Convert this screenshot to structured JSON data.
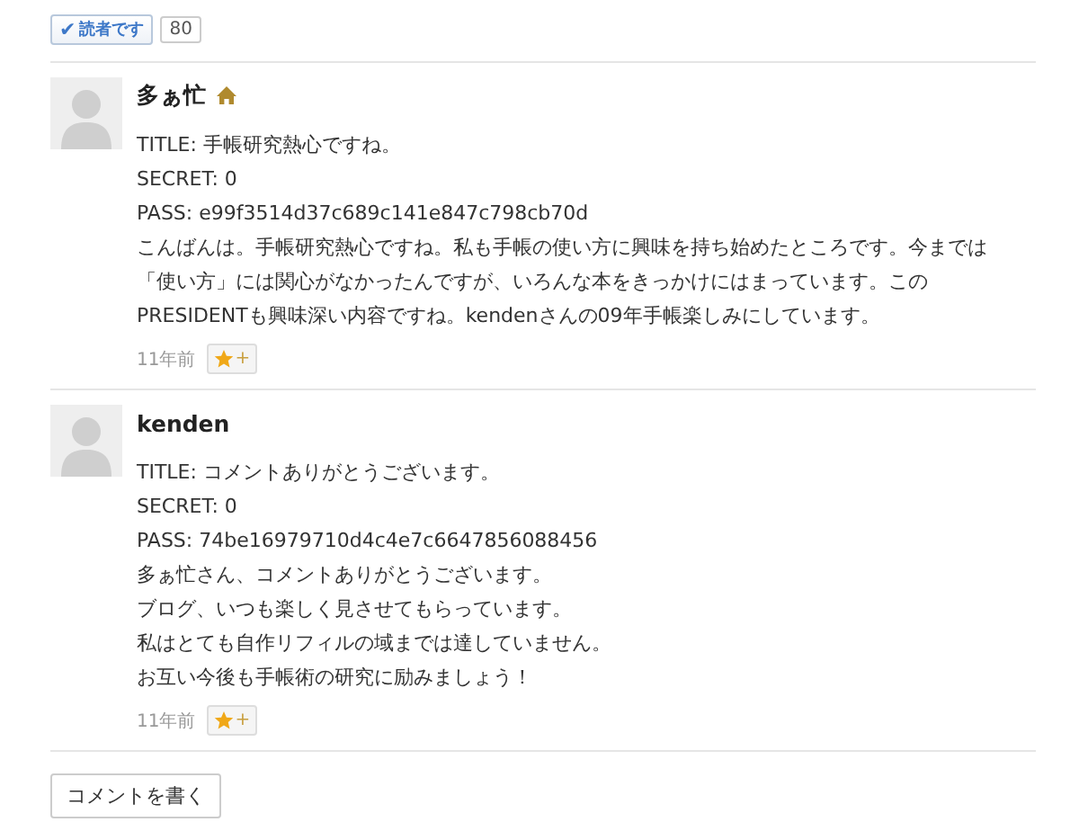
{
  "reader_badge": {
    "check": "✔",
    "label": "読者です",
    "count": "80"
  },
  "comments": [
    {
      "author": "多ぁ忙",
      "home_icon": true,
      "lines": [
        "TITLE: 手帳研究熱心ですね。",
        "SECRET: 0",
        "PASS: e99f3514d37c689c141e847c798cb70d",
        "こんばんは。手帳研究熱心ですね。私も手帳の使い方に興味を持ち始めたところです。今までは",
        "「使い方」には関心がなかったんですが、いろんな本をきっかけにはまっています。この",
        "PRESIDENTも興味深い内容ですね。kendenさんの09年手帳楽しみにしています。"
      ],
      "time": "11年前",
      "star_plus": "+"
    },
    {
      "author": "kenden",
      "home_icon": false,
      "lines": [
        "TITLE: コメントありがとうございます。",
        "SECRET: 0",
        "PASS: 74be16979710d4c4e7c6647856088456",
        "多ぁ忙さん、コメントありがとうございます。",
        "ブログ、いつも楽しく見させてもらっています。",
        "私はとても自作リフィルの域までは達していません。",
        "お互い今後も手帳術の研究に励みましょう！"
      ],
      "time": "11年前",
      "star_plus": "+"
    }
  ],
  "write_button": "コメントを書く"
}
